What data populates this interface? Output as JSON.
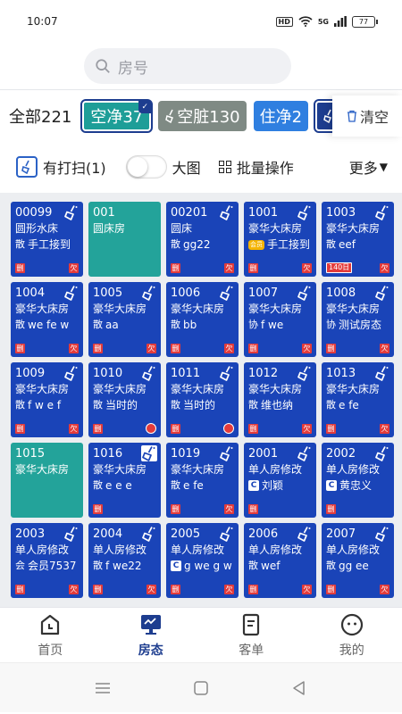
{
  "status": {
    "time": "10:07",
    "hd": "HD",
    "signal": "5G",
    "battery": "77"
  },
  "search": {
    "placeholder": "房号"
  },
  "filters": {
    "all": "全部221",
    "clean_vacant": "空净37",
    "dirty_vacant": "空脏130",
    "clean_occupied": "住净2",
    "clear": "清空"
  },
  "tools": {
    "has_cleaning": "有打扫(1)",
    "big_view": "大图",
    "batch": "批量操作",
    "more": "更多"
  },
  "rooms": [
    {
      "num": "00099",
      "type": "圆形水床",
      "tag": "散",
      "guest": "手工接到",
      "color": "blue",
      "b1": "删",
      "b2": "欠"
    },
    {
      "num": "001",
      "type": "圆床房",
      "color": "teal"
    },
    {
      "num": "00201",
      "type": "圆床",
      "tag": "散",
      "guest": "gg22",
      "color": "blue",
      "b1": "删",
      "b2": "欠"
    },
    {
      "num": "1001",
      "type": "豪华大床房",
      "tag": "",
      "guest": "手工接到",
      "color": "blue",
      "b1": "删",
      "b2": "欠",
      "tagbadge": "会员"
    },
    {
      "num": "1003",
      "type": "豪华大床房",
      "tag": "散",
      "guest": "eef",
      "color": "blue",
      "days": "140日",
      "b2": "欠"
    },
    {
      "num": "1004",
      "type": "豪华大床房",
      "tag": "散",
      "guest": "we fe w",
      "color": "blue",
      "b1": "删",
      "b2": "欠"
    },
    {
      "num": "1005",
      "type": "豪华大床房",
      "tag": "散",
      "guest": "aa",
      "color": "blue",
      "b1": "删",
      "b2": "欠"
    },
    {
      "num": "1006",
      "type": "豪华大床房",
      "tag": "散",
      "guest": "bb",
      "color": "blue",
      "b1": "删",
      "b2": "欠"
    },
    {
      "num": "1007",
      "type": "豪华大床房",
      "tag": "协",
      "guest": "f we",
      "color": "blue",
      "b1": "删",
      "b2": "欠"
    },
    {
      "num": "1008",
      "type": "豪华大床房",
      "tag": "协",
      "guest": "测试房态",
      "color": "blue",
      "b1": "删",
      "b2": "欠"
    },
    {
      "num": "1009",
      "type": "豪华大床房",
      "tag": "散",
      "guest": "f w e f",
      "color": "blue",
      "b1": "删",
      "b2": "欠"
    },
    {
      "num": "1010",
      "type": "豪华大床房",
      "tag": "散",
      "guest": "当时的",
      "color": "blue",
      "b1": "删",
      "alarm": true
    },
    {
      "num": "1011",
      "type": "豪华大床房",
      "tag": "散",
      "guest": "当时的",
      "color": "blue",
      "b1": "删",
      "alarm": true
    },
    {
      "num": "1012",
      "type": "豪华大床房",
      "tag": "散",
      "guest": "维也纳",
      "color": "blue",
      "b1": "删",
      "b2": "欠"
    },
    {
      "num": "1013",
      "type": "豪华大床房",
      "tag": "散",
      "guest": "e fe",
      "color": "blue",
      "b1": "删",
      "b2": "欠"
    },
    {
      "num": "1015",
      "type": "豪华大床房",
      "color": "teal"
    },
    {
      "num": "1016",
      "type": "豪华大床房",
      "tag": "散",
      "guest": "e e e",
      "color": "blue",
      "b1": "删",
      "boxbroom": true
    },
    {
      "num": "1019",
      "type": "豪华大床房",
      "tag": "散",
      "guest": "e fe",
      "color": "blue",
      "b1": "删",
      "b2": "欠"
    },
    {
      "num": "2001",
      "type": "单人房修改",
      "tag": "C",
      "guest": "刘颖",
      "color": "blue",
      "b1": "删",
      "blue": true
    },
    {
      "num": "2002",
      "type": "单人房修改",
      "tag": "C",
      "guest": "黄忠义",
      "color": "blue",
      "b1": "删",
      "blue": true
    },
    {
      "num": "2003",
      "type": "单人房修改",
      "tag": "会",
      "guest": "会员7537",
      "color": "blue",
      "b1": "删",
      "b2": "欠"
    },
    {
      "num": "2004",
      "type": "单人房修改",
      "tag": "散",
      "guest": "f we22",
      "color": "blue",
      "b1": "删",
      "b2": "欠"
    },
    {
      "num": "2005",
      "type": "单人房修改",
      "tag": "C",
      "guest": "g we g w",
      "color": "blue",
      "b1": "删",
      "b2": "欠",
      "blue": true
    },
    {
      "num": "2006",
      "type": "单人房修改",
      "tag": "散",
      "guest": "wef",
      "color": "blue",
      "b1": "删",
      "b2": "欠"
    },
    {
      "num": "2007",
      "type": "单人房修改",
      "tag": "散",
      "guest": "gg ee",
      "color": "blue",
      "b1": "删",
      "b2": "欠"
    }
  ],
  "nav": {
    "home": "首页",
    "room_status": "房态",
    "orders": "客单",
    "mine": "我的"
  }
}
